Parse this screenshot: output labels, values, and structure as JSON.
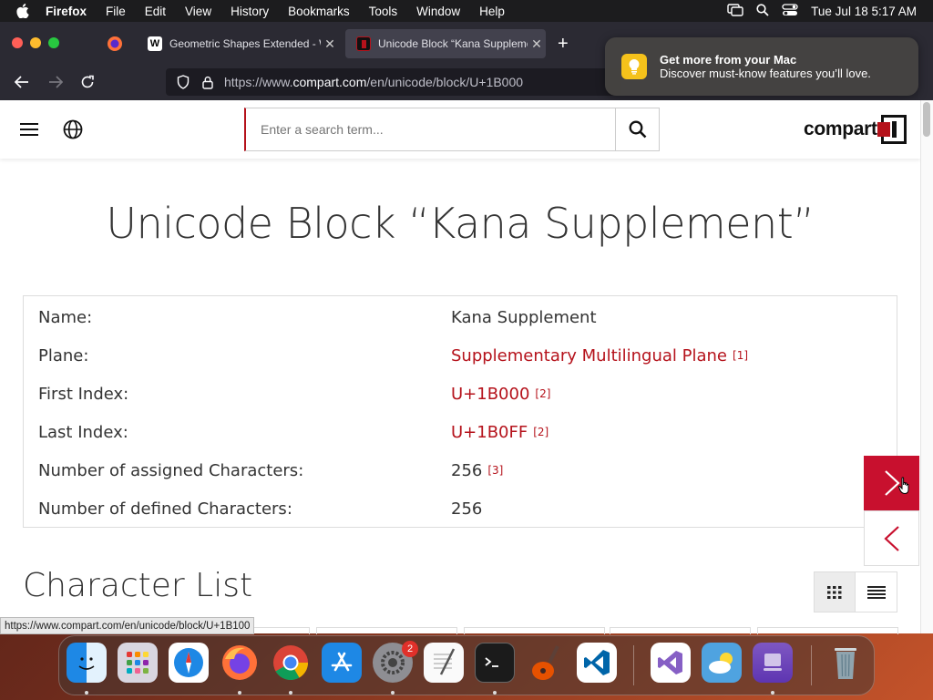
{
  "menubar": {
    "app": "Firefox",
    "items": [
      "File",
      "Edit",
      "View",
      "History",
      "Bookmarks",
      "Tools",
      "Window",
      "Help"
    ],
    "datetime": "Tue Jul 18  5:17 AM"
  },
  "tabs": [
    {
      "title": "Geometric Shapes Extended - W"
    },
    {
      "title": "Unicode Block “Kana Suppleme"
    }
  ],
  "address": {
    "prefix": "https://www.",
    "domain": "compart.com",
    "path": "/en/unicode/block/U+1B000"
  },
  "notification": {
    "title": "Get more from your Mac",
    "body": "Discover must-know features you’ll love."
  },
  "search": {
    "placeholder": "Enter a search term..."
  },
  "logo": {
    "text": "compart"
  },
  "page": {
    "title": "Unicode Block “Kana Supplement”",
    "section": "Character List"
  },
  "info": [
    {
      "label": "Name:",
      "value": "Kana Supplement",
      "ref": ""
    },
    {
      "label": "Plane:",
      "value": "Supplementary Multilingual Plane",
      "ref": "[1]"
    },
    {
      "label": "First Index:",
      "value": "U+1B000",
      "ref": "[2]"
    },
    {
      "label": "Last Index:",
      "value": "U+1B0FF",
      "ref": "[2]"
    },
    {
      "label": "Number of assigned Characters:",
      "value": "256",
      "ref": "[3]"
    },
    {
      "label": "Number of defined Characters:",
      "value": "256",
      "ref": ""
    }
  ],
  "status_url": "https://www.compart.com/en/unicode/block/U+1B100",
  "dock": {
    "badge": "2"
  },
  "colors": {
    "accent": "#b5121b",
    "next_button": "#c8102e"
  }
}
